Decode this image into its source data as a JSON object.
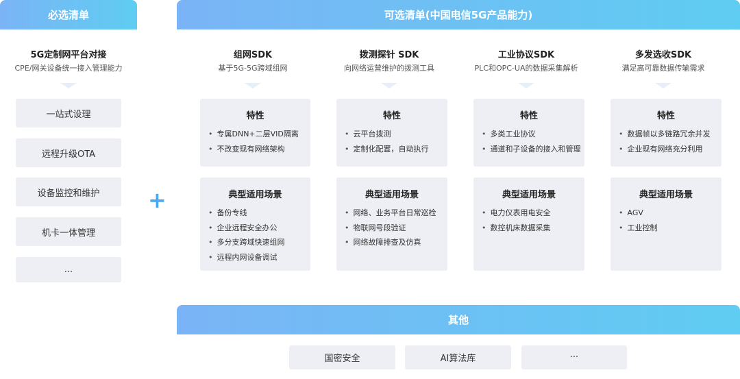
{
  "required": {
    "header": "必选清单",
    "title": "5G定制网平台对接",
    "subtitle": "CPE/网关设备统一接入管理能力",
    "items": [
      "一站式设理",
      "远程升级OTA",
      "设备监控和维护",
      "机卡一体管理",
      "..."
    ]
  },
  "plus_symbol": "+",
  "optional": {
    "header": "可选清单(中国电信5G产品能力)",
    "columns": [
      {
        "title": "组网SDK",
        "subtitle": "基于5G-5G跨域组网",
        "features_title": "特性",
        "features": [
          "专属DNN+二层VID隔离",
          "不改变现有网络架构"
        ],
        "scenarios_title": "典型适用场景",
        "scenarios": [
          "备份专线",
          "企业远程安全办公",
          "多分支跨域快速组网",
          "远程内网设备调试"
        ]
      },
      {
        "title": "拨测探针 SDK",
        "subtitle": "向网络运营维护的拨测工具",
        "features_title": "特性",
        "features": [
          "云平台拨测",
          "定制化配置，自动执行"
        ],
        "scenarios_title": "典型适用场景",
        "scenarios": [
          "网络、业务平台日常巡检",
          "物联网号段验证",
          "网络故障排查及仿真"
        ]
      },
      {
        "title": "工业协议SDK",
        "subtitle": "PLC和OPC-UA的数据采集解析",
        "features_title": "特性",
        "features": [
          "多类工业协议",
          "通道和子设备的接入和管理"
        ],
        "scenarios_title": "典型适用场景",
        "scenarios": [
          "电力仪表用电安全",
          "数控机床数据采集"
        ]
      },
      {
        "title": "多发选收SDK",
        "subtitle": "满足高可靠数据传输需求",
        "features_title": "特性",
        "features": [
          "数据帧以多链路冗余并发",
          "企业现有网络充分利用"
        ],
        "scenarios_title": "典型适用场景",
        "scenarios": [
          "AGV",
          "工业控制"
        ]
      }
    ]
  },
  "other": {
    "header": "其他",
    "items": [
      "国密安全",
      "AI算法库",
      "···"
    ]
  }
}
